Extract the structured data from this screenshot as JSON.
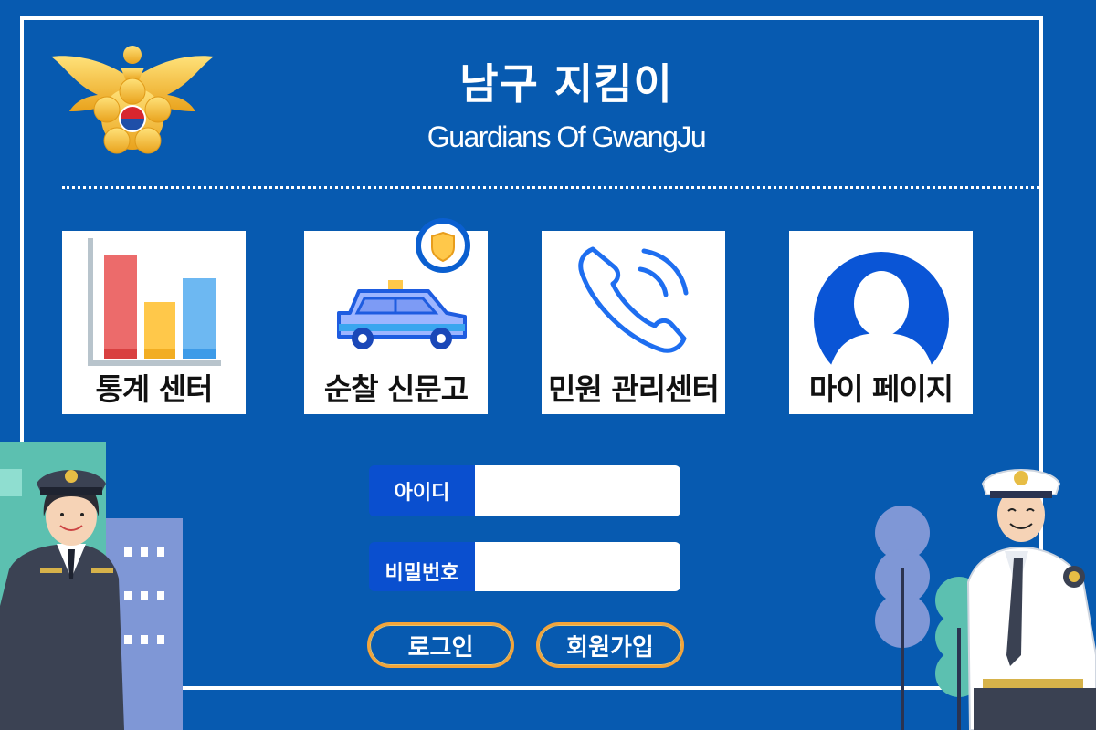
{
  "header": {
    "title": "남구 지킴이",
    "subtitle": "Guardians Of GwangJu"
  },
  "menu": {
    "items": [
      {
        "label": "통계 센터",
        "icon": "bar-chart-icon"
      },
      {
        "label": "순찰 신문고",
        "icon": "police-car-icon"
      },
      {
        "label": "민원 관리센터",
        "icon": "phone-icon"
      },
      {
        "label": "마이 페이지",
        "icon": "user-icon"
      }
    ]
  },
  "login": {
    "id_label": "아이디",
    "id_value": "",
    "password_label": "비밀번호",
    "password_value": "",
    "login_button": "로그인",
    "signup_button": "회원가입"
  },
  "colors": {
    "background": "#075ab0",
    "label_bg": "#0a4fcf",
    "button_border": "#f3a43a"
  }
}
